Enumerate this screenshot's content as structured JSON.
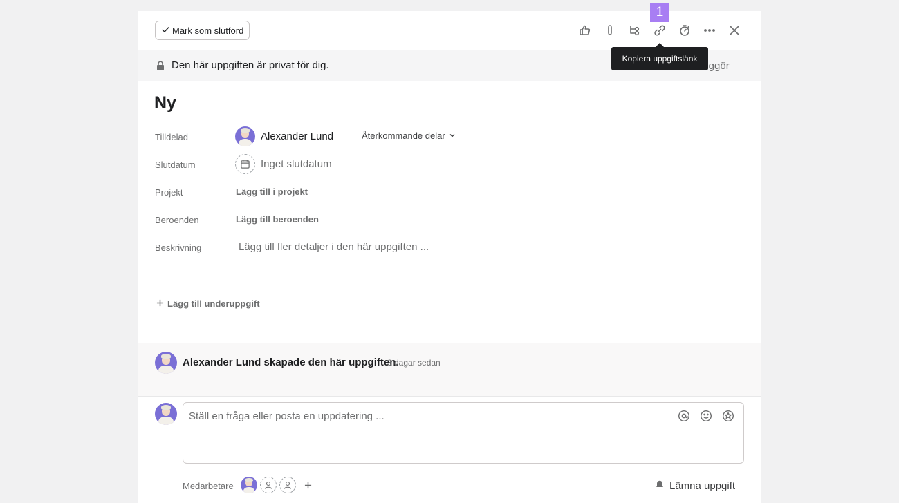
{
  "toolbar": {
    "complete_label": "Märk som slutförd",
    "tooltip": "Kopiera uppgiftslänk",
    "badge": "1",
    "icons": [
      "thumbs-up-icon",
      "attachment-icon",
      "subtask-icon",
      "link-icon",
      "timer-icon",
      "more-icon",
      "close-icon"
    ]
  },
  "privacy": {
    "text": "Den här uppgiften är privat för dig.",
    "action_partial": "liggör"
  },
  "task": {
    "title": "Ny"
  },
  "fields": {
    "assignee_label": "Tilldelad",
    "assignee_name": "Alexander Lund",
    "recurring_label": "Återkommande delar",
    "due_label": "Slutdatum",
    "due_value": "Inget slutdatum",
    "project_label": "Projekt",
    "project_action": "Lägg till i projekt",
    "deps_label": "Beroenden",
    "deps_action": "Lägg till beroenden",
    "desc_label": "Beskrivning",
    "desc_placeholder": "Lägg till fler detaljer i den här uppgiften ..."
  },
  "subtasks": {
    "add_label": "Lägg till underuppgift"
  },
  "activity": {
    "text": "Alexander Lund skapade den här uppgiften.",
    "time": "3 dagar sedan"
  },
  "composer": {
    "placeholder": "Ställ en fråga eller posta en uppdatering ..."
  },
  "collaborators": {
    "label": "Medarbetare",
    "leave_label": "Lämna uppgift"
  },
  "colors": {
    "accent_badge": "#a87ef3",
    "tooltip_bg": "#1e1f21"
  }
}
